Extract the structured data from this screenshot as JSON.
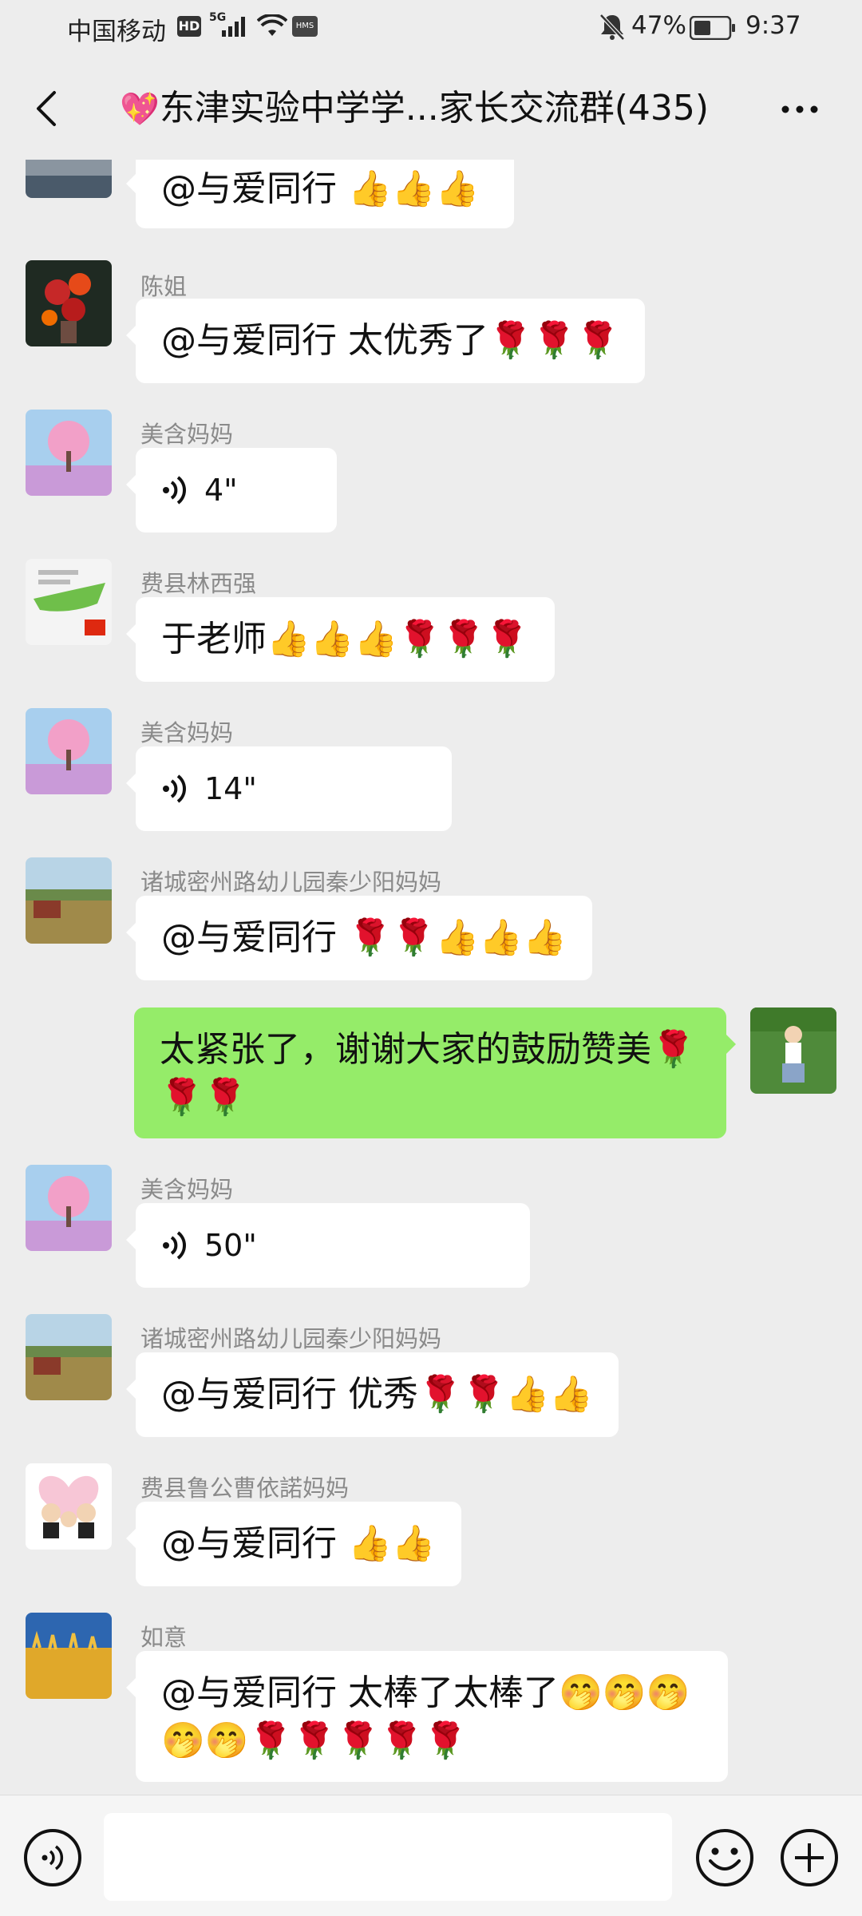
{
  "status_bar": {
    "carrier": "中国移动",
    "hd": "HD",
    "network": "5G",
    "hms": "HMS",
    "battery_pct": "47%",
    "time": "9:37",
    "icons": [
      "signal-icon",
      "wifi-icon",
      "mute-icon",
      "battery-icon"
    ]
  },
  "header": {
    "title_emoji": "💖",
    "title": "东津实验中学学...家长交流群(435)",
    "back_icon": "back-icon",
    "more_icon": "more-icon"
  },
  "messages": [
    {
      "sender": "",
      "text": "@与爱同行 👍👍👍"
    },
    {
      "sender": "陈姐",
      "text": "@与爱同行  太优秀了🌹🌹🌹"
    },
    {
      "sender": "美含妈妈",
      "voice": "4\""
    },
    {
      "sender": "费县林西强",
      "text": "于老师👍👍👍🌹🌹🌹"
    },
    {
      "sender": "美含妈妈",
      "voice": "14\""
    },
    {
      "sender": "诸城密州路幼儿园秦少阳妈妈",
      "text": "@与爱同行  🌹🌹👍👍👍"
    },
    {
      "sender": "",
      "mine": true,
      "text": "太紧张了，谢谢大家的鼓励赞美🌹🌹🌹"
    },
    {
      "sender": "美含妈妈",
      "voice": "50\""
    },
    {
      "sender": "诸城密州路幼儿园秦少阳妈妈",
      "text": "@与爱同行  优秀🌹🌹👍👍"
    },
    {
      "sender": "费县鲁公曹依諾妈妈",
      "text": "@与爱同行  👍👍"
    },
    {
      "sender": "如意",
      "text": "@与爱同行  太棒了太棒了🤭🤭🤭🤭🤭🌹🌹🌹🌹🌹"
    }
  ],
  "input_bar": {
    "icons": [
      "voice-input-icon",
      "emoji-icon",
      "plus-icon"
    ]
  },
  "colors": {
    "background": "#ededed",
    "mine_bubble": "#95ec69",
    "other_bubble": "#ffffff",
    "sender_text": "#8a8a8a"
  }
}
